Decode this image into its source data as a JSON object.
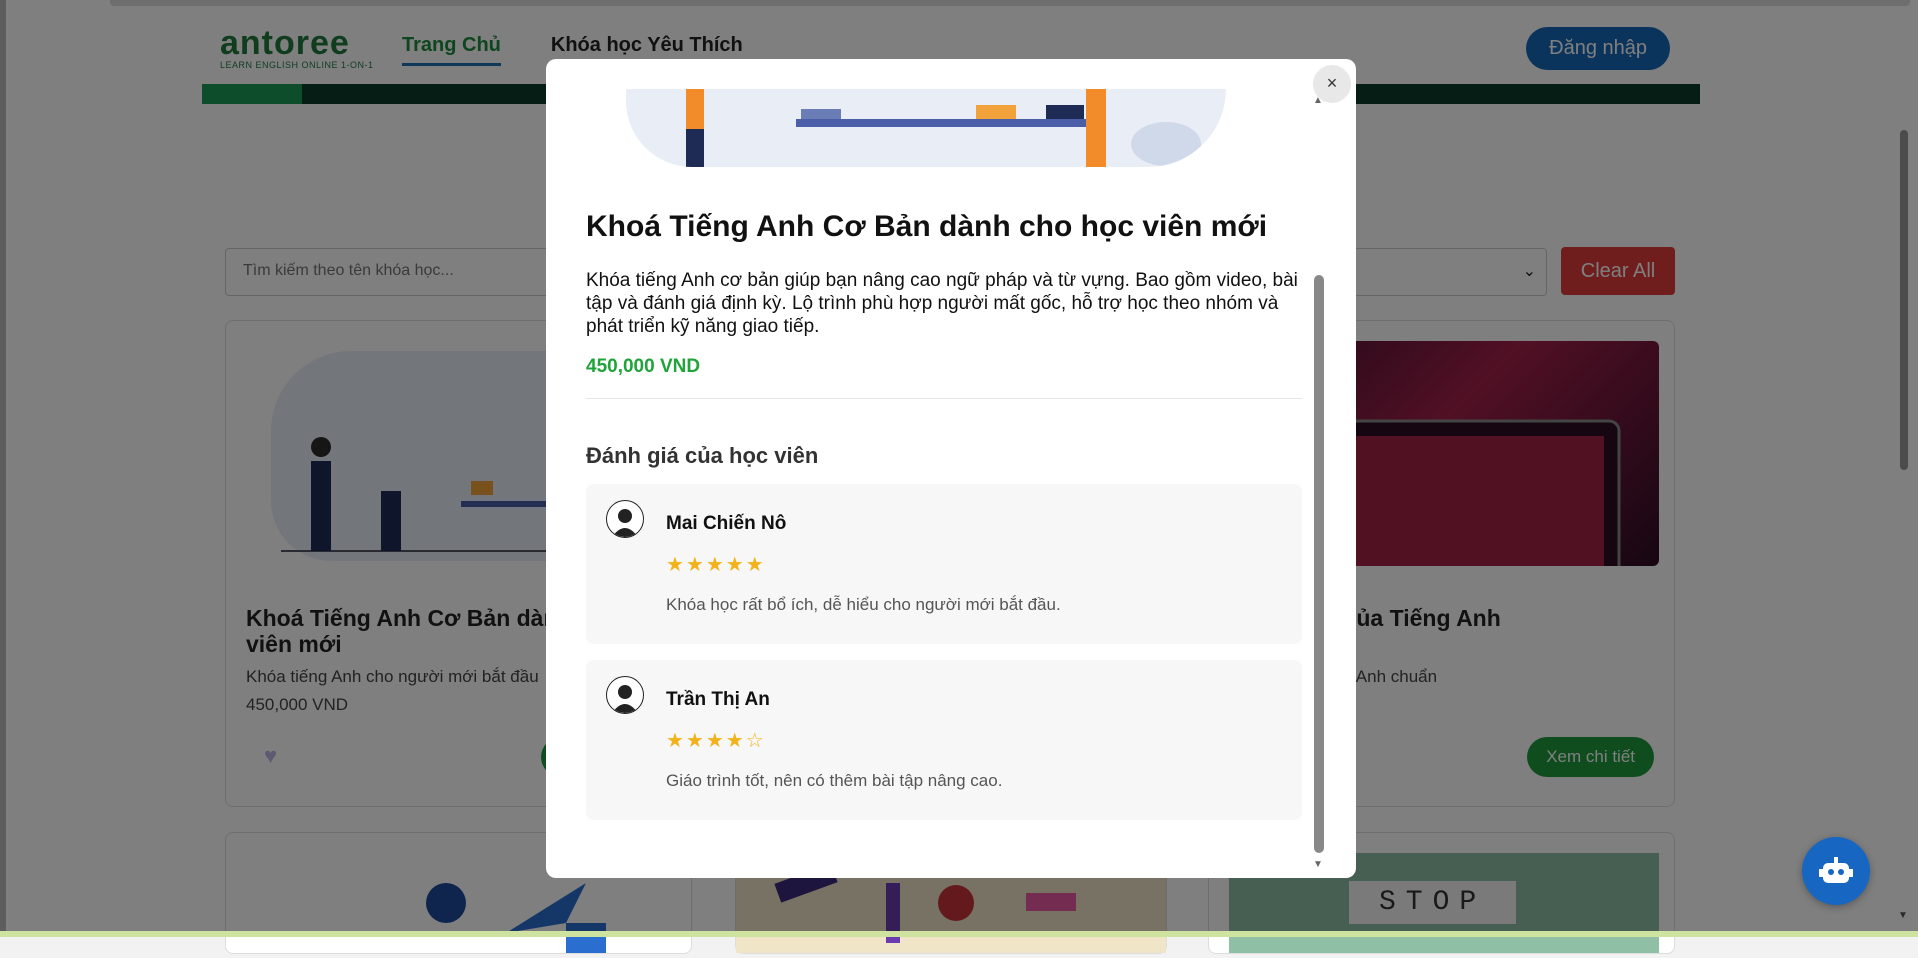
{
  "header": {
    "logo_brand": "antoree",
    "logo_tagline": "LEARN ENGLISH ONLINE 1-ON-1",
    "nav": [
      {
        "label": "Trang Chủ"
      },
      {
        "label": "Khóa học Yêu Thích"
      }
    ],
    "login_label": "Đăng nhập"
  },
  "filters": {
    "search_placeholder": "Tìm kiếm theo tên khóa học...",
    "clear_label": "Clear All"
  },
  "cards": [
    {
      "title": "Khoá Tiếng Anh Cơ Bản dành cho học viên mới",
      "desc": "Khóa tiếng Anh cho người mới bắt đầu",
      "price": "450,000 VND"
    },
    {
      "title": "Ngữ Âm của Tiếng Anh",
      "title_visible": "ngữ Âm của Tiếng Anh",
      "desc_visible": "phát âm tiếng Anh chuẩn",
      "detail_label": "Xem chi tiết"
    },
    {
      "stop_text": "STOP"
    }
  ],
  "modal": {
    "close_label": "×",
    "title": "Khoá Tiếng Anh Cơ Bản dành cho học viên mới",
    "description": "Khóa tiếng Anh cơ bản giúp bạn nâng cao ngữ pháp và từ vựng. Bao gồm video, bài tập và đánh giá định kỳ. Lộ trình phù hợp người mất gốc, hỗ trợ học theo nhóm và phát triển kỹ năng giao tiếp.",
    "price": "450,000 VND",
    "reviews_heading": "Đánh giá của học viên",
    "reviews": [
      {
        "name": "Mai Chiến Nô",
        "rating": 5,
        "stars": "★★★★★",
        "comment": "Khóa học rất bổ ích, dễ hiểu cho người mới bắt đầu."
      },
      {
        "name": "Trần Thị An",
        "rating": 4,
        "stars": "★★★★☆",
        "comment": "Giáo trình tốt, nên có thêm bài tập nâng cao."
      }
    ]
  },
  "colors": {
    "brand_green": "#1f7a3d",
    "login_blue": "#1768b8",
    "clear_red": "#e03a3a",
    "price_green": "#20a43a",
    "star_gold": "#f2b21a",
    "chatbot_blue": "#1766c2"
  },
  "icons": {
    "close": "close-icon",
    "heart": "heart-icon",
    "chatbot": "robot-icon",
    "avatar": "user-avatar-icon",
    "select": "chevron-down-icon"
  }
}
